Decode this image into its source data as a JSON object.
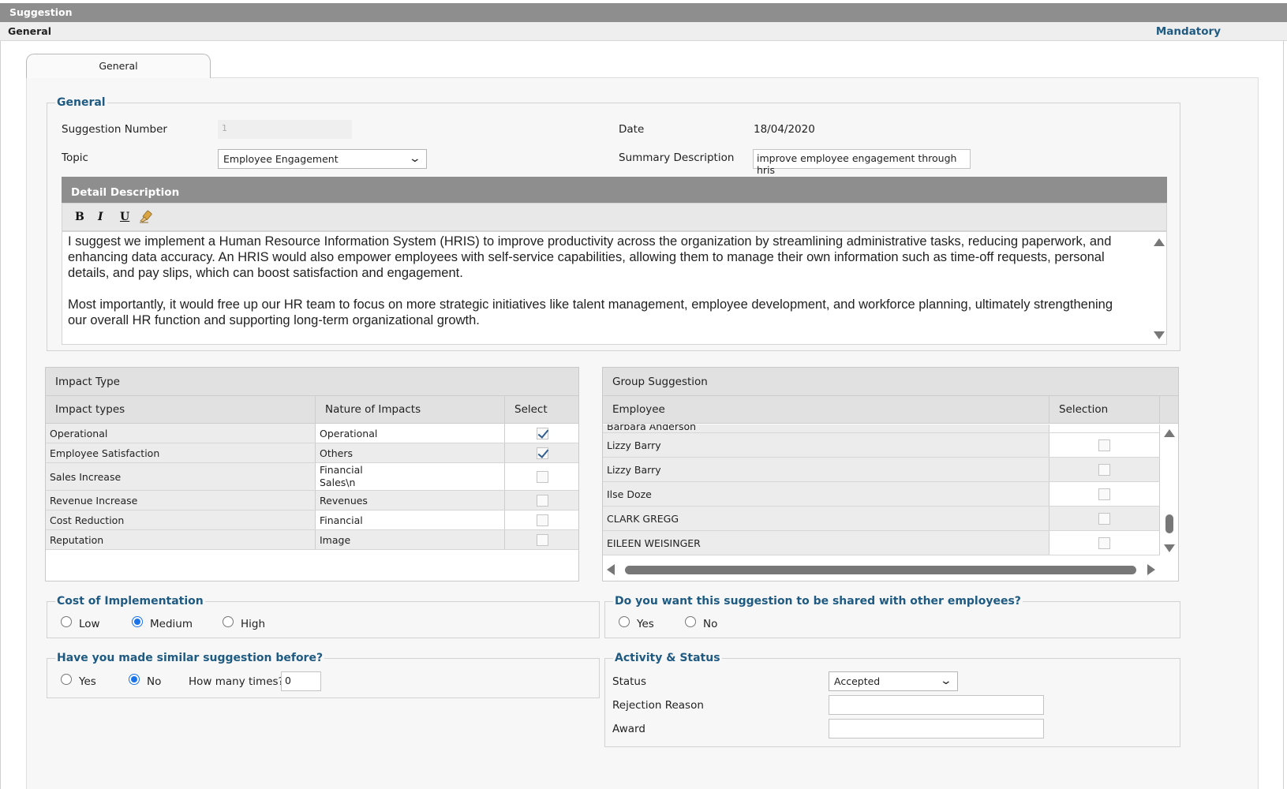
{
  "app": {
    "title": "Suggestion",
    "section": "General",
    "mandatory_label": "Mandatory"
  },
  "tabs": [
    {
      "label": "General"
    }
  ],
  "general": {
    "legend": "General",
    "suggestion_number_label": "Suggestion Number",
    "suggestion_number_value": "1",
    "date_label": "Date",
    "date_value": "18/04/2020",
    "topic_label": "Topic",
    "topic_value": "Employee Engagement",
    "summary_label": "Summary Description",
    "summary_value": "improve employee engagement through hris",
    "detail": {
      "header": "Detail Description",
      "toolbar": {
        "bold": "B",
        "italic": "I",
        "underline": "U",
        "clear_icon": "eraser-icon"
      },
      "paragraph1": "I suggest we implement a Human Resource Information System (HRIS) to improve productivity across the organization by streamlining administrative tasks, reducing paperwork, and enhancing data accuracy. An HRIS would also empower employees with self-service capabilities, allowing them to manage their own information such as time-off requests, personal details, and pay slips, which can boost satisfaction and engagement.",
      "paragraph2": "Most importantly, it would free up our HR team to focus on more strategic initiatives like talent management, employee development, and workforce planning, ultimately strengthening our overall HR function and supporting long-term organizational growth."
    }
  },
  "impact": {
    "title": "Impact Type",
    "columns": [
      "Impact types",
      "Nature of Impacts",
      "Select"
    ],
    "rows": [
      {
        "type": "Operational",
        "nature": "Operational",
        "nature2": "",
        "selected": true
      },
      {
        "type": "Employee Satisfaction",
        "nature": "Others",
        "nature2": "",
        "selected": true
      },
      {
        "type": "Sales Increase",
        "nature": "Financial",
        "nature2": "Sales\\n",
        "selected": false
      },
      {
        "type": "Revenue Increase",
        "nature": "Revenues",
        "nature2": "",
        "selected": false
      },
      {
        "type": "Cost Reduction",
        "nature": "Financial",
        "nature2": "",
        "selected": false
      },
      {
        "type": "Reputation",
        "nature": "Image",
        "nature2": "",
        "selected": false
      }
    ]
  },
  "group": {
    "title": "Group Suggestion",
    "columns": [
      "Employee",
      "Selection"
    ],
    "partial_row": "Barbara Anderson",
    "rows": [
      {
        "employee": "Lizzy Barry",
        "selected": false
      },
      {
        "employee": "Lizzy Barry",
        "selected": false
      },
      {
        "employee": "Ilse Doze",
        "selected": false
      },
      {
        "employee": "CLARK GREGG",
        "selected": false
      },
      {
        "employee": "EILEEN WEISINGER",
        "selected": false
      }
    ]
  },
  "cost": {
    "legend": "Cost of Implementation",
    "options": [
      "Low",
      "Medium",
      "High"
    ],
    "selected": "Medium"
  },
  "share": {
    "legend": "Do you want this suggestion to be shared with other employees?",
    "options": [
      "Yes",
      "No"
    ],
    "selected": ""
  },
  "similar": {
    "legend": "Have you made similar suggestion before?",
    "options": [
      "Yes",
      "No"
    ],
    "selected": "No",
    "times_label": "How many times?",
    "times_value": "0"
  },
  "activity": {
    "legend": "Activity & Status",
    "status_label": "Status",
    "status_value": "Accepted",
    "rejection_label": "Rejection Reason",
    "rejection_value": "",
    "award_label": "Award",
    "award_value": ""
  }
}
